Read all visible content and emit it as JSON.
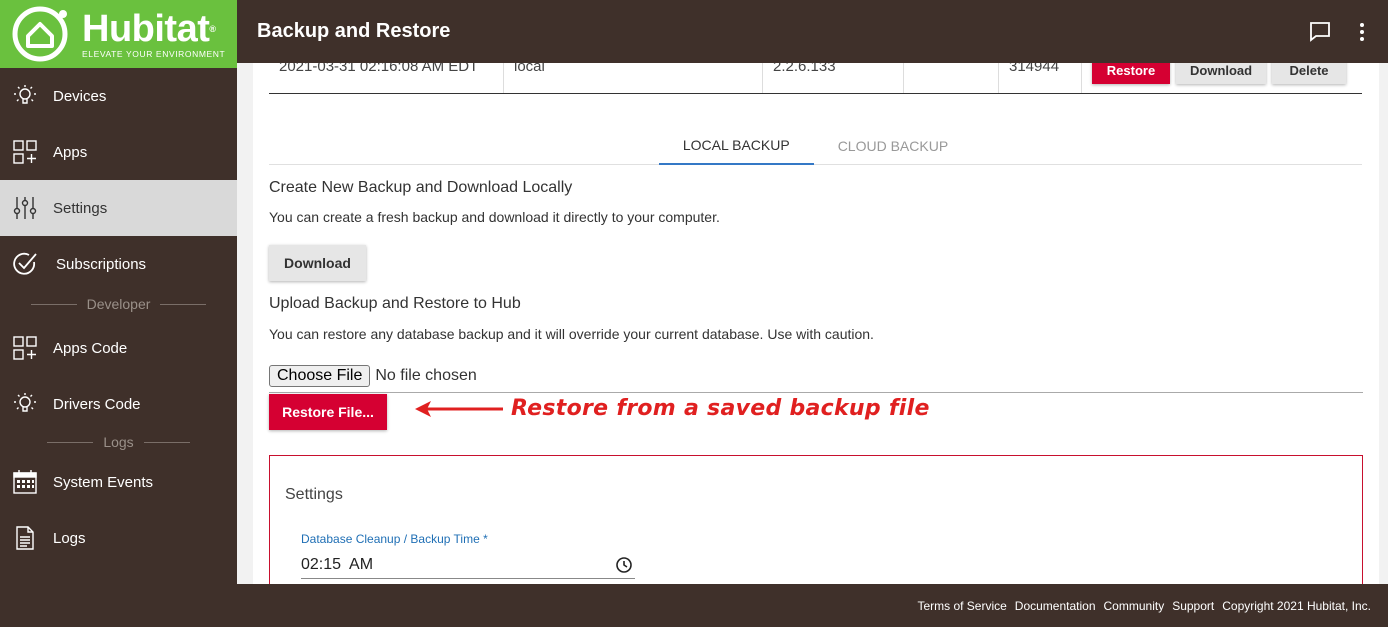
{
  "brand": {
    "name": "Hubitat",
    "tagline": "ELEVATE YOUR ENVIRONMENT"
  },
  "sidebar": {
    "items": [
      {
        "label": "Devices",
        "icon": "bulb-icon"
      },
      {
        "label": "Apps",
        "icon": "apps-grid-icon"
      },
      {
        "label": "Settings",
        "icon": "sliders-icon",
        "active": true
      },
      {
        "label": "Subscriptions",
        "icon": "check-circle-icon"
      }
    ],
    "developer_label": "Developer",
    "dev_items": [
      {
        "label": "Apps Code",
        "icon": "apps-grid-icon"
      },
      {
        "label": "Drivers Code",
        "icon": "bulb-icon"
      }
    ],
    "logs_label": "Logs",
    "log_items": [
      {
        "label": "System Events",
        "icon": "calendar-icon"
      },
      {
        "label": "Logs",
        "icon": "document-icon"
      }
    ]
  },
  "header": {
    "title": "Backup and Restore"
  },
  "backup_row": {
    "date": "2021-03-31 02:16:08 AM EDT",
    "type": "local",
    "version": "2.2.6.133",
    "extra": "",
    "size": "314944",
    "restore_label": "Restore",
    "download_label": "Download",
    "delete_label": "Delete"
  },
  "tabs": [
    {
      "label": "LOCAL BACKUP",
      "active": true
    },
    {
      "label": "CLOUD BACKUP",
      "active": false
    }
  ],
  "local_backup": {
    "create_title": "Create New Backup and Download Locally",
    "create_desc": "You can create a fresh backup and download it directly to your computer.",
    "download_label": "Download",
    "upload_title": "Upload Backup and Restore to Hub",
    "upload_desc": "You can restore any database backup and it will override your current database. Use with caution.",
    "choose_file_label": "Choose File",
    "no_file_text": "No file chosen",
    "restore_file_label": "Restore File..."
  },
  "annotation": {
    "text": "Restore from a saved backup file",
    "color": "#e02020"
  },
  "settings": {
    "title": "Settings",
    "time_label": "Database Cleanup / Backup Time *",
    "time_value": "02:15  AM"
  },
  "footer": {
    "links": [
      "Terms of Service",
      "Documentation",
      "Community",
      "Support"
    ],
    "copyright": "Copyright 2021 Hubitat, Inc."
  },
  "colors": {
    "sidebar": "#3f302a",
    "brand_green": "#6ac13e",
    "accent_red": "#d50032",
    "tab_blue": "#3478c6"
  }
}
